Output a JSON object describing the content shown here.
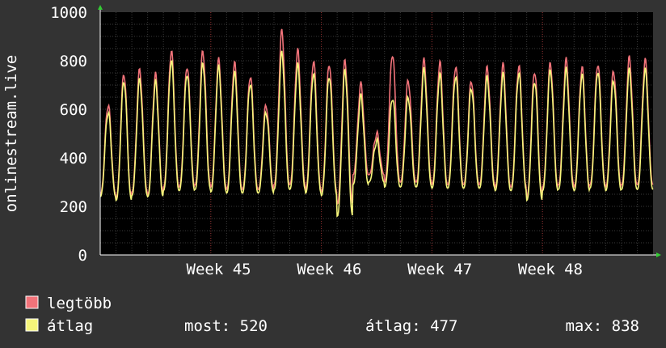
{
  "colors": {
    "background": "#333333",
    "plot_bg": "#000000",
    "grid": "#3a3a3a",
    "week_grid": "#8b2a2a",
    "max_series": "#f2737a",
    "avg_series": "#f5f57a",
    "arrow": "#33cc33"
  },
  "chart_data": {
    "type": "line",
    "ylabel": "onlinestream.live",
    "ylim": [
      0,
      1000
    ],
    "yticks": [
      "0",
      "200",
      "400",
      "600",
      "800",
      "1000"
    ],
    "xrange_days": [
      0,
      35
    ],
    "xticks": [
      {
        "label": "Week 45",
        "day": 7
      },
      {
        "label": "Week 46",
        "day": 14
      },
      {
        "label": "Week 47",
        "day": 21
      },
      {
        "label": "Week 48",
        "day": 28
      }
    ],
    "daily_peaks_max": [
      620,
      750,
      760,
      740,
      840,
      780,
      840,
      800,
      790,
      740,
      620,
      920,
      840,
      800,
      790,
      800,
      700,
      500,
      830,
      720,
      800,
      790,
      780,
      720,
      770,
      780,
      780,
      760,
      790,
      800,
      770,
      790,
      760,
      810,
      800
    ],
    "daily_troughs_max": [
      250,
      235,
      260,
      250,
      280,
      280,
      290,
      280,
      270,
      270,
      270,
      290,
      290,
      270,
      260,
      210,
      330,
      330,
      300,
      300,
      300,
      290,
      290,
      290,
      290,
      280,
      280,
      240,
      280,
      290,
      280,
      290,
      280,
      290,
      290
    ],
    "daily_peaks_avg": [
      590,
      720,
      720,
      710,
      800,
      750,
      790,
      770,
      750,
      710,
      590,
      830,
      780,
      750,
      740,
      760,
      650,
      470,
      650,
      650,
      760,
      740,
      740,
      690,
      730,
      740,
      750,
      720,
      760,
      760,
      740,
      760,
      720,
      760,
      760
    ],
    "daily_troughs_avg": [
      240,
      225,
      245,
      240,
      265,
      265,
      270,
      260,
      255,
      255,
      255,
      270,
      270,
      255,
      245,
      160,
      290,
      300,
      280,
      280,
      280,
      275,
      275,
      275,
      275,
      265,
      265,
      225,
      265,
      270,
      265,
      275,
      265,
      270,
      270
    ],
    "series": [
      {
        "name": "legtöbb",
        "color": "#f2737a"
      },
      {
        "name": "átlag",
        "color": "#f5f57a"
      }
    ]
  },
  "legend": {
    "max_label": "legtöbb",
    "avg_label": "átlag",
    "now_label": "most: 520",
    "avg_stat_label": "átlag: 477",
    "max_stat_label": "max: 838"
  }
}
